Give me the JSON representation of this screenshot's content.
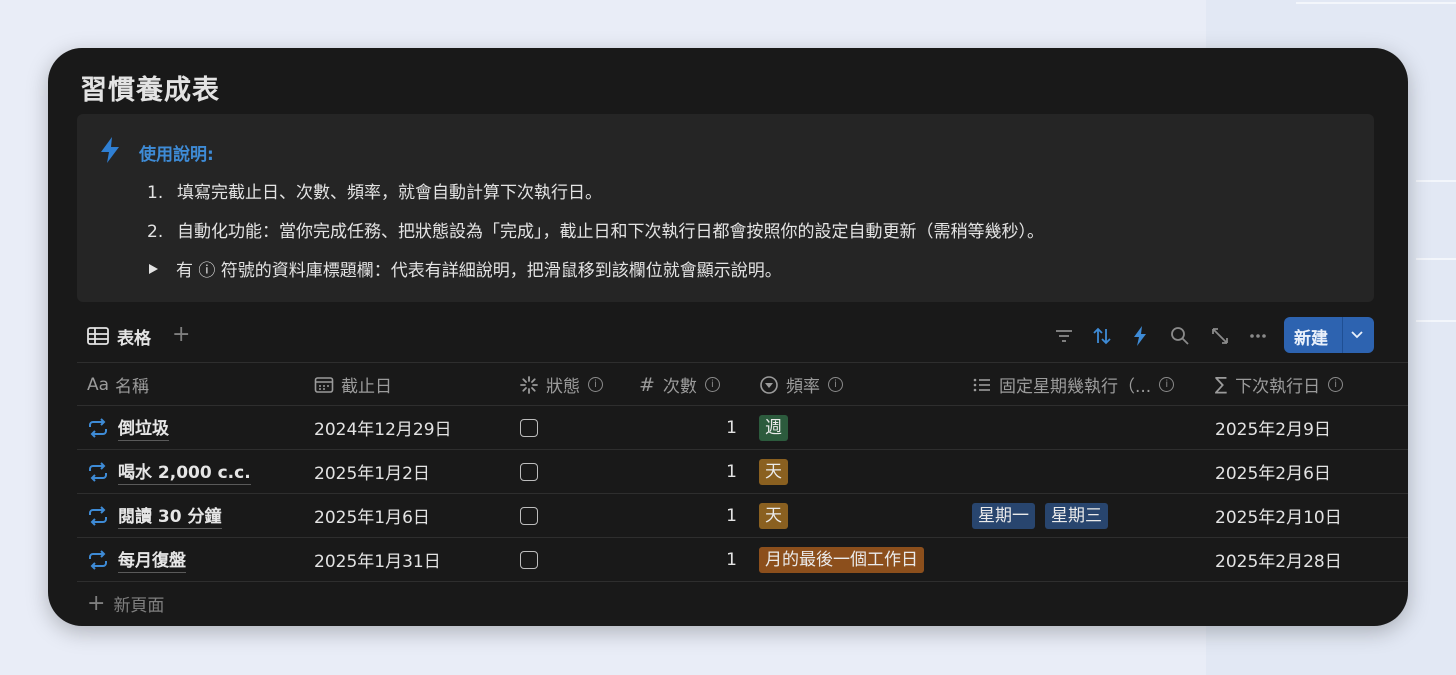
{
  "page": {
    "title": "習慣養成表",
    "colors": {
      "background": "#191919",
      "accent": "#2d63b0",
      "callout": "#252525"
    }
  },
  "callout": {
    "icon": "lightning-icon",
    "title": "使用說明:",
    "lines": [
      {
        "num": "1.",
        "text": "填寫完截止日、次數、頻率，就會自動計算下次執行日。"
      },
      {
        "num": "2.",
        "text": "自動化功能：當你完成任務、把狀態設為「完成」，截止日和下次執行日都會按照你的設定自動更新（需稍等幾秒）。"
      },
      {
        "text": "有 ⓘ 符號的資料庫標題欄：代表有詳細說明，把滑鼠移到該欄位就會顯示說明。"
      }
    ]
  },
  "view": {
    "tab_label": "表格",
    "add_icon": "plus-icon",
    "tools": [
      "filter-icon",
      "sort-icon",
      "lightning-icon",
      "search-icon",
      "expand-icon",
      "more-icon"
    ],
    "new_button": "新建"
  },
  "table": {
    "headers": [
      "名稱",
      "截止日",
      "狀態",
      "次數",
      "頻率",
      "固定星期幾執行（...",
      "下次執行日"
    ],
    "header_prefix": "Aa",
    "rows": [
      {
        "name": "倒垃圾",
        "due": "2024年12月29日",
        "done": false,
        "count": "1",
        "freq": "週",
        "freq_color": "#2c5b3d",
        "weekdays": [],
        "next": "2025年2月9日"
      },
      {
        "name": "喝水 2,000 c.c.",
        "due": "2025年1月2日",
        "done": false,
        "count": "1",
        "freq": "天",
        "freq_color": "#8a6020",
        "weekdays": [],
        "next": "2025年2月6日"
      },
      {
        "name": "閱讀 30 分鐘",
        "due": "2025年1月6日",
        "done": false,
        "count": "1",
        "freq": "天",
        "freq_color": "#8a6020",
        "weekdays": [
          "星期一",
          "星期三"
        ],
        "next": "2025年2月10日"
      },
      {
        "name": "每月復盤",
        "due": "2025年1月31日",
        "done": false,
        "count": "1",
        "freq": "月的最後一個工作日",
        "freq_color": "#8c4f1c",
        "weekdays": [],
        "next": "2025年2月28日"
      }
    ],
    "weekday_color": "#28456e",
    "add_row_label": "新頁面"
  }
}
